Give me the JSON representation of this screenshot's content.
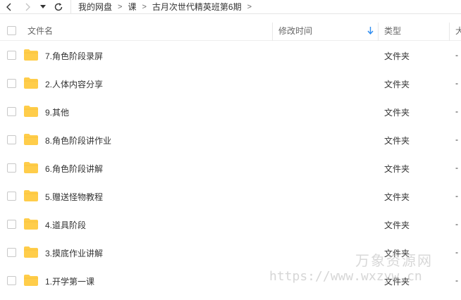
{
  "nav": {
    "breadcrumbs": [
      "我的网盘",
      "课",
      "古月次世代精英班第6期"
    ],
    "separator": ">"
  },
  "header": {
    "name_label": "文件名",
    "modified_label": "修改时间",
    "type_label": "类型",
    "size_label": "大"
  },
  "files": [
    {
      "name": "7.角色阶段录屏",
      "type": "文件夹",
      "size": "-"
    },
    {
      "name": "2.人体内容分享",
      "type": "文件夹",
      "size": "-"
    },
    {
      "name": "9.其他",
      "type": "文件夹",
      "size": "-"
    },
    {
      "name": "8.角色阶段讲作业",
      "type": "文件夹",
      "size": "-"
    },
    {
      "name": "6.角色阶段讲解",
      "type": "文件夹",
      "size": "-"
    },
    {
      "name": "5.赠送怪物教程",
      "type": "文件夹",
      "size": "-"
    },
    {
      "name": "4.道具阶段",
      "type": "文件夹",
      "size": "-"
    },
    {
      "name": "3.摸底作业讲解",
      "type": "文件夹",
      "size": "-"
    },
    {
      "name": "1.开学第一课",
      "type": "文件夹",
      "size": "-"
    }
  ],
  "watermark": {
    "title": "万象资源网",
    "url": "https://www.wxzyw.cn"
  },
  "colors": {
    "folder": "#ffcd4a",
    "sort_arrow": "#2d8cf0"
  },
  "icons": {
    "back": "chevron-left-icon",
    "forward": "chevron-right-icon",
    "history": "caret-down-icon",
    "refresh": "refresh-icon",
    "sort": "arrow-down-icon",
    "folder": "folder-icon"
  }
}
